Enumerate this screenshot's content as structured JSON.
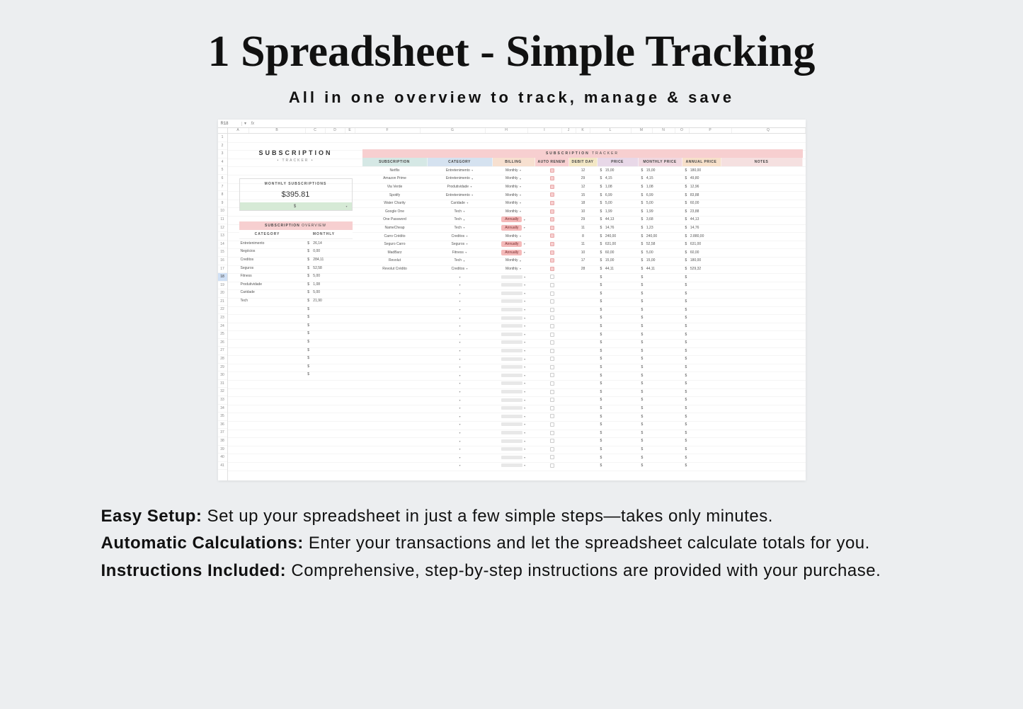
{
  "header": {
    "title": "1 Spreadsheet - Simple Tracking",
    "subtitle": "All in one overview to track, manage & save"
  },
  "formula_bar": {
    "cell_ref": "R18",
    "fx": "fx"
  },
  "col_letters": [
    "A",
    "B",
    "C",
    "D",
    "E",
    "F",
    "G",
    "H",
    "I",
    "J",
    "K",
    "L",
    "M",
    "N",
    "O",
    "P",
    "Q"
  ],
  "sidebar": {
    "logo": "SUBSCRIPTION",
    "logo_sub": "• TRACKER •",
    "monthly_box_title": "MONTHLY SUBSCRIPTIONS",
    "monthly_amount": "$395.81",
    "monthly_input_currency": "$"
  },
  "overview": {
    "title_prefix": "SUBSCRIPTION ",
    "title_suffix": "OVERVIEW",
    "head_category": "CATEGORY",
    "head_monthly": "MONTHLY",
    "rows": [
      {
        "cat": "Entretenimento",
        "val": "26,14"
      },
      {
        "cat": "Negócios",
        "val": "0,00"
      },
      {
        "cat": "Creditos",
        "val": "284,11"
      },
      {
        "cat": "Seguros",
        "val": "52,58"
      },
      {
        "cat": "Fitness",
        "val": "5,00"
      },
      {
        "cat": "Produtividade",
        "val": "1,08"
      },
      {
        "cat": "Caridade",
        "val": "5,00"
      },
      {
        "cat": "Tech",
        "val": "21,90"
      }
    ],
    "currency": "$"
  },
  "tracker": {
    "title_prefix": "SUBSCRIPTION ",
    "title_suffix": "TRACKER",
    "headers": {
      "subscription": "SUBSCRIPTION",
      "category": "CATEGORY",
      "billing": "BILLING",
      "auto_renew": "AUTO RENEW",
      "debit_day": "DEBIT DAY",
      "price": "PRICE",
      "monthly_price": "MONTHLY PRICE",
      "annual_price": "ANNUAL PRICE",
      "notes": "NOTES"
    },
    "currency": "$",
    "rows": [
      {
        "sub": "Netflix",
        "cat": "Entretenimento",
        "bill": "Monthly",
        "bill_type": "m",
        "auto": true,
        "day": "12",
        "price": "15,00",
        "month": "15,00",
        "annual": "180,00"
      },
      {
        "sub": "Amazon Prime",
        "cat": "Entretenimento",
        "bill": "Monthly",
        "bill_type": "m",
        "auto": true,
        "day": "29",
        "price": "4,15",
        "month": "4,15",
        "annual": "49,80"
      },
      {
        "sub": "Via Verde",
        "cat": "Produtividade",
        "bill": "Monthly",
        "bill_type": "m",
        "auto": true,
        "day": "12",
        "price": "1,08",
        "month": "1,08",
        "annual": "12,96"
      },
      {
        "sub": "Spotify",
        "cat": "Entretenimento",
        "bill": "Monthly",
        "bill_type": "m",
        "auto": true,
        "day": "15",
        "price": "6,99",
        "month": "6,99",
        "annual": "83,88"
      },
      {
        "sub": "Water Charity",
        "cat": "Caridade",
        "bill": "Monthly",
        "bill_type": "m",
        "auto": true,
        "day": "18",
        "price": "5,00",
        "month": "5,00",
        "annual": "60,00"
      },
      {
        "sub": "Google One",
        "cat": "Tech",
        "bill": "Monthly",
        "bill_type": "m",
        "auto": true,
        "day": "10",
        "price": "1,99",
        "month": "1,99",
        "annual": "23,88"
      },
      {
        "sub": "One Password",
        "cat": "Tech",
        "bill": "Annually",
        "bill_type": "a",
        "auto": true,
        "day": "29",
        "price": "44,13",
        "month": "3,68",
        "annual": "44,13"
      },
      {
        "sub": "NameCheap",
        "cat": "Tech",
        "bill": "Annually",
        "bill_type": "a",
        "auto": true,
        "day": "11",
        "price": "14,76",
        "month": "1,23",
        "annual": "14,76"
      },
      {
        "sub": "Carro Crédito",
        "cat": "Creditos",
        "bill": "Monthly",
        "bill_type": "m",
        "auto": true,
        "day": "8",
        "price": "240,00",
        "month": "240,00",
        "annual": "2.880,00"
      },
      {
        "sub": "Seguro Carro",
        "cat": "Seguros",
        "bill": "Annually",
        "bill_type": "a",
        "auto": true,
        "day": "11",
        "price": "631,00",
        "month": "52,58",
        "annual": "631,00"
      },
      {
        "sub": "MadBarz",
        "cat": "Fitness",
        "bill": "Annually",
        "bill_type": "a",
        "auto": true,
        "day": "10",
        "price": "60,00",
        "month": "5,00",
        "annual": "60,00"
      },
      {
        "sub": "Revolut",
        "cat": "Tech",
        "bill": "Monthly",
        "bill_type": "m",
        "auto": true,
        "day": "17",
        "price": "15,00",
        "month": "15,00",
        "annual": "180,00"
      },
      {
        "sub": "Revolut Crédito",
        "cat": "Creditos",
        "bill": "Monthly",
        "bill_type": "m",
        "auto": true,
        "day": "28",
        "price": "44,11",
        "month": "44,11",
        "annual": "529,32"
      }
    ]
  },
  "features": [
    {
      "bold": "Easy Setup:",
      "rest": " Set up your spreadsheet in just a few simple steps—takes only minutes."
    },
    {
      "bold": "Automatic Calculations:",
      "rest": " Enter your transactions and let the spreadsheet calculate totals for you."
    },
    {
      "bold": "Instructions Included:",
      "rest": " Comprehensive, step-by-step instructions are provided with your purchase."
    }
  ]
}
